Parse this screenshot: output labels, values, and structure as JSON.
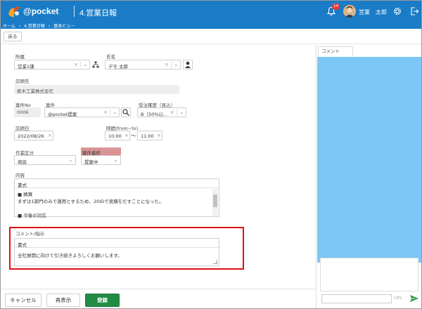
{
  "header": {
    "brand": "@pocket",
    "page_title": "4.営業日報",
    "notification_count": "14",
    "user_name": "営業　太郎"
  },
  "breadcrumb": [
    "ホーム",
    "›",
    "4.営業日報",
    "›",
    "基本ビュー"
  ],
  "toolbar": {
    "back_label": "戻る"
  },
  "form": {
    "shozoku": {
      "label": "所属",
      "value": "営業1課"
    },
    "shimei": {
      "label": "氏名",
      "value": "デモ 太郎"
    },
    "houmonsaki": {
      "label": "訪問先",
      "value": "栃木工業株式会社"
    },
    "anken_no": {
      "label": "案件No",
      "value": "0006"
    },
    "anken": {
      "label": "案件",
      "value": "@pocket提案"
    },
    "juchu": {
      "label": "受注確度（見込）",
      "value": "B（50%以..."
    },
    "houmonbi": {
      "label": "訪問日",
      "value": "2022/08/26"
    },
    "jikan": {
      "label": "時間(from~to)",
      "from": "10:00",
      "tilde": "～",
      "to": "11:00"
    },
    "sagyo": {
      "label": "作業区分",
      "value": "商談"
    },
    "shinchoku": {
      "label": "案件進捗",
      "value": "提案中"
    },
    "naiyou": {
      "label": "内容",
      "toolbar": "書式",
      "lines": [
        "■ 精算",
        "まずは1部門のみで運用とするため、20IDで見積をだすことになった。",
        "",
        "■ 今後の対応"
      ]
    },
    "comment": {
      "label": "コメント/指示",
      "toolbar": "書式",
      "text": "全社展開に向けて引き続きよろしくお願いします。"
    }
  },
  "actions": {
    "cancel": "キャンセル",
    "redisplay": "再表示",
    "register": "登録"
  },
  "comment_panel": {
    "tab": "コメント",
    "link": "URL"
  },
  "colors": {
    "header_bg": "#1a7cc7",
    "comment_panel_bg": "#7cc7f5",
    "register_btn": "#228b44",
    "progress_label_bg": "#d99494",
    "highlight": "#e01010"
  }
}
